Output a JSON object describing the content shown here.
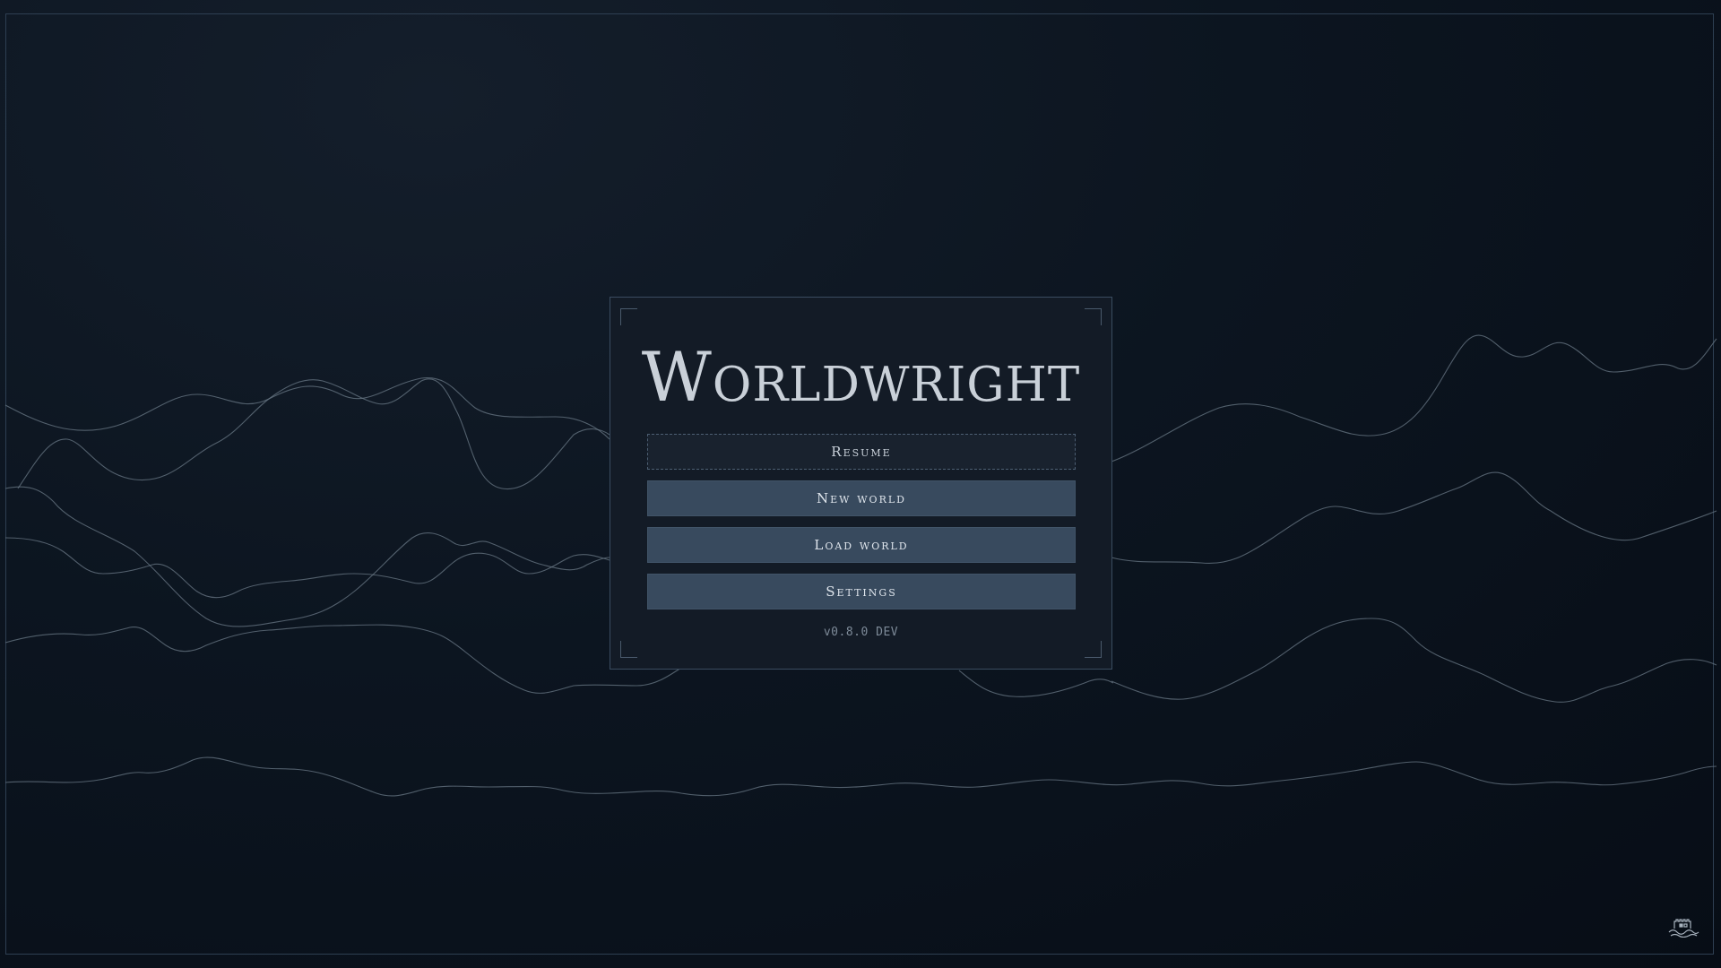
{
  "app": {
    "title": "Worldwright",
    "version": "v0.8.0 DEV"
  },
  "menu": {
    "resume_label": "Resume",
    "new_world_label": "New world",
    "load_world_label": "Load world",
    "settings_label": "Settings"
  },
  "icons": {
    "corner_logo": "castle-icon"
  },
  "colors": {
    "background": "#0a121c",
    "panel": "#131b26",
    "button": "#384a5e",
    "title_text": "#c9d0d8"
  }
}
